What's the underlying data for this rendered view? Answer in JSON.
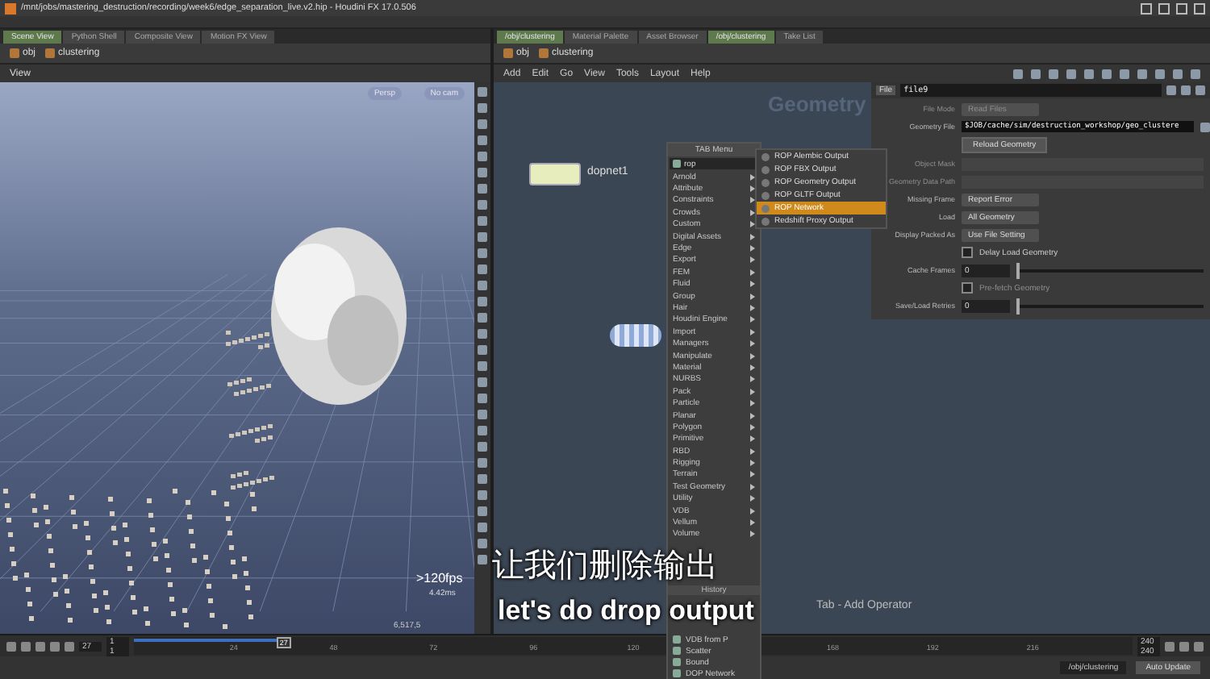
{
  "window": {
    "title": "/mnt/jobs/mastering_destruction/recording/week6/edge_separation_live.v2.hip - Houdini FX 17.0.506"
  },
  "left_pane": {
    "tabs": [
      {
        "label": "Scene View",
        "selected": true
      },
      {
        "label": "Python Shell",
        "selected": false
      },
      {
        "label": "Composite View",
        "selected": false
      },
      {
        "label": "Motion FX View",
        "selected": false
      }
    ],
    "path": [
      "obj",
      "clustering"
    ],
    "viewport": {
      "menu": "View",
      "camera": "Persp",
      "camera_menu": "No cam",
      "fps": ">120fps",
      "time": "4.42ms",
      "count": "6,517,5"
    }
  },
  "right_pane": {
    "tabs": [
      {
        "label": "/obj/clustering",
        "selected": true
      },
      {
        "label": "Material Palette",
        "selected": false
      },
      {
        "label": "Asset Browser",
        "selected": false
      },
      {
        "label": "/obj/clustering",
        "selected": true
      },
      {
        "label": "Take List",
        "selected": false
      }
    ],
    "path": [
      "obj",
      "clustering"
    ],
    "menu": [
      "Add",
      "Edit",
      "Go",
      "View",
      "Tools",
      "Layout",
      "Help"
    ],
    "network": {
      "context": "Geometry",
      "node": "dopnet1",
      "hint": "Tab - Add Operator"
    },
    "parameters": {
      "node_type": "File",
      "node_name": "file9",
      "rows": [
        {
          "kind": "dropdown",
          "label": "File Mode",
          "value": "Read Files",
          "disabled": true
        },
        {
          "kind": "file",
          "label": "Geometry File",
          "value": "$JOB/cache/sim/destruction_workshop/geo_clustere",
          "disabled": false
        },
        {
          "kind": "button",
          "value": "Reload Geometry",
          "disabled": false
        },
        {
          "kind": "empty",
          "label": "Object Mask",
          "disabled": true
        },
        {
          "kind": "empty",
          "label": "Geometry Data Path",
          "disabled": true
        },
        {
          "kind": "dropdown",
          "label": "Missing Frame",
          "value": "Report Error",
          "disabled": false
        },
        {
          "kind": "dropdown",
          "label": "Load",
          "value": "All Geometry",
          "disabled": false
        },
        {
          "kind": "dropdown",
          "label": "Display Packed As",
          "value": "Use File Setting",
          "disabled": false
        },
        {
          "kind": "checkbox",
          "value": "Delay Load Geometry",
          "checked": false,
          "disabled": false
        },
        {
          "kind": "slider",
          "label": "Cache Frames",
          "value": "0",
          "level": 0,
          "disabled": false
        },
        {
          "kind": "checkbox",
          "value": "Pre-fetch Geometry",
          "checked": false,
          "disabled": true
        },
        {
          "kind": "slider",
          "label": "Save/Load Retries",
          "value": "0",
          "level": 0,
          "disabled": false
        }
      ]
    }
  },
  "tab_menu": {
    "title": "TAB Menu",
    "search": "rop",
    "categories": [
      "Arnold",
      "Attribute",
      "Constraints",
      "Crowds",
      "Custom",
      "Digital Assets",
      "Edge",
      "Export",
      "FEM",
      "Fluid",
      "Group",
      "Hair",
      "Houdini Engine",
      "Import",
      "Managers",
      "Manipulate",
      "Material",
      "NURBS",
      "Pack",
      "Particle",
      "Planar",
      "Polygon",
      "Primitive",
      "RBD",
      "Rigging",
      "Terrain",
      "Test Geometry",
      "Utility",
      "VDB",
      "Vellum",
      "Volume"
    ],
    "history_title": "History",
    "history": [
      "VDB from P",
      "Scatter",
      "Bound",
      "DOP Network"
    ],
    "results": [
      {
        "label": "ROP Alembic Output",
        "selected": false
      },
      {
        "label": "ROP FBX Output",
        "selected": false
      },
      {
        "label": "ROP Geometry Output",
        "selected": false
      },
      {
        "label": "ROP GLTF Output",
        "selected": false
      },
      {
        "label": "ROP Network",
        "selected": true
      },
      {
        "label": "Redshift Proxy Output",
        "selected": false
      }
    ]
  },
  "timeline": {
    "frame": "27",
    "start": "1",
    "start_2": "1",
    "end": "240",
    "end_2": "240",
    "playhead": "27",
    "level": 0.15,
    "ticks": [
      "24",
      "48",
      "72",
      "96",
      "120",
      "168",
      "192",
      "216"
    ]
  },
  "status_bar": {
    "path": "/obj/clustering",
    "update_mode": "Auto Update"
  },
  "subtitles": {
    "chinese": "让我们删除输出",
    "english": "let's do drop output"
  }
}
